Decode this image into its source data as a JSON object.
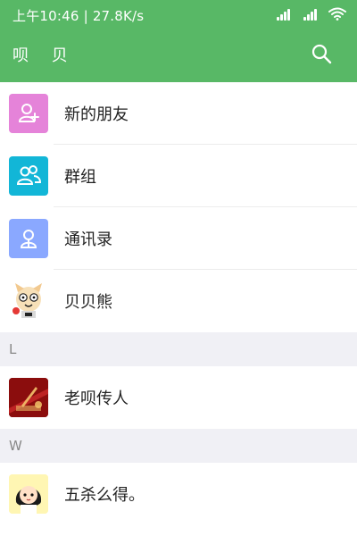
{
  "status_bar": {
    "time_speed": "上午10:46 | 27.8K/s"
  },
  "appbar": {
    "title": "呗 贝",
    "search_icon": "search-icon"
  },
  "contacts": {
    "top_items": [
      {
        "label": "新的朋友",
        "icon": "add-friend-icon",
        "color": "#e583d9"
      },
      {
        "label": "群组",
        "icon": "group-icon",
        "color": "#12b6d7"
      },
      {
        "label": "通讯录",
        "icon": "contacts-book-icon",
        "color": "#8aa8ff"
      },
      {
        "label": "贝贝熊",
        "icon": "avatar-dog"
      }
    ],
    "sections": [
      {
        "letter": "L",
        "items": [
          {
            "label": "老呗传人",
            "icon": "avatar-red-poster"
          }
        ]
      },
      {
        "letter": "W",
        "items": [
          {
            "label": "五杀么得。",
            "icon": "avatar-cartoon-girl"
          }
        ]
      }
    ]
  },
  "colors": {
    "header_green": "#58b866"
  }
}
